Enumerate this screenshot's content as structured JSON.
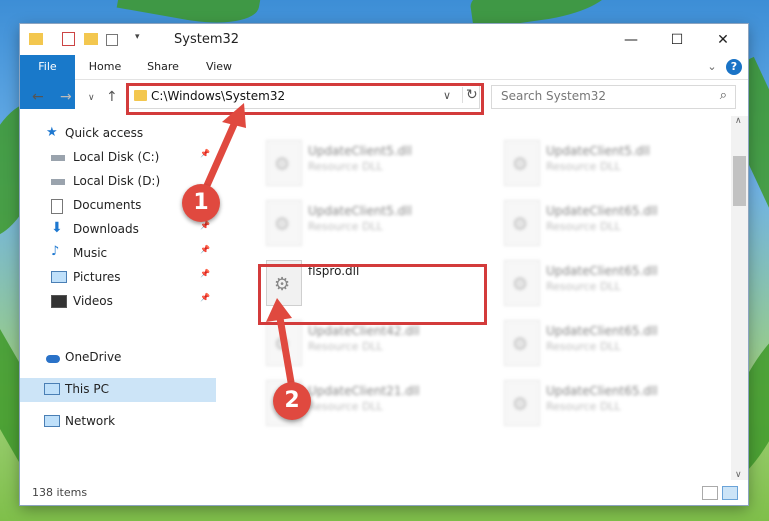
{
  "window": {
    "title": "System32"
  },
  "window_controls": {
    "minimize": "—",
    "maximize": "☐",
    "close": "✕"
  },
  "ribbon": {
    "file": "File",
    "home": "Home",
    "share": "Share",
    "view": "View",
    "help": "?"
  },
  "address": {
    "path": "C:\\Windows\\System32",
    "dropdown": "∨",
    "refresh": "↻"
  },
  "search": {
    "placeholder": "Search System32"
  },
  "nav_buttons": {
    "back": "←",
    "forward": "→",
    "recent": "∨",
    "up": "↑"
  },
  "sidebar": {
    "quick_access": "Quick access",
    "items": [
      {
        "label": "Local Disk (C:)",
        "icon": "drive-icon",
        "pinned": true
      },
      {
        "label": "Local Disk (D:)",
        "icon": "drive-icon",
        "pinned": false
      },
      {
        "label": "Documents",
        "icon": "documents-icon",
        "pinned": true
      },
      {
        "label": "Downloads",
        "icon": "downloads-icon",
        "pinned": true
      },
      {
        "label": "Music",
        "icon": "music-icon",
        "pinned": true
      },
      {
        "label": "Pictures",
        "icon": "pictures-icon",
        "pinned": true
      },
      {
        "label": "Videos",
        "icon": "videos-icon",
        "pinned": true
      }
    ],
    "onedrive": "OneDrive",
    "thispc": "This PC",
    "network": "Network"
  },
  "files": [
    {
      "name": "UpdateClient5.dll",
      "type": "Resource DLL"
    },
    {
      "name": "UpdateClient5.dll",
      "type": "Resource DLL"
    },
    {
      "name": "UpdateClient5.dll",
      "type": "Resource DLL"
    },
    {
      "name": "UpdateClient65.dll",
      "type": "Resource DLL"
    },
    {
      "name": "flspro.dll",
      "type": ""
    },
    {
      "name": "UpdateClient65.dll",
      "type": "Resource DLL"
    },
    {
      "name": "UpdateClient42.dll",
      "type": "Resource DLL"
    },
    {
      "name": "UpdateClient65.dll",
      "type": "Resource DLL"
    },
    {
      "name": "UpdateClient21.dll",
      "type": "Resource DLL"
    },
    {
      "name": "UpdateClient65.dll",
      "type": "Resource DLL"
    }
  ],
  "status": {
    "count": "138 items"
  },
  "markers": {
    "one": "1",
    "two": "2"
  },
  "colors": {
    "highlight": "#d33b3b",
    "accent": "#1979ca",
    "selection": "#cce4f7"
  }
}
